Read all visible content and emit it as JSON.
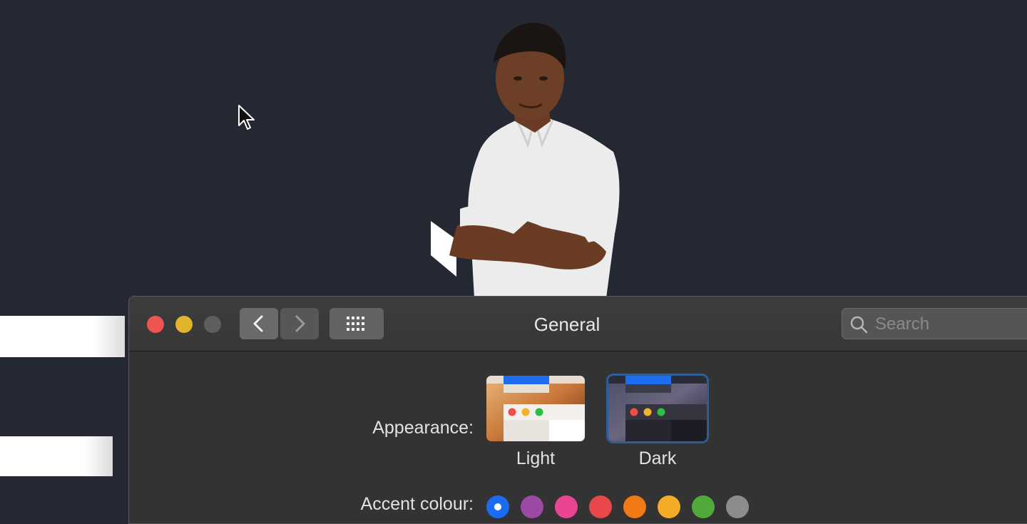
{
  "window": {
    "title": "General",
    "search_placeholder": "Search"
  },
  "appearance": {
    "label": "Appearance:",
    "options": [
      {
        "name": "Light",
        "selected": false
      },
      {
        "name": "Dark",
        "selected": true
      }
    ]
  },
  "accent": {
    "label": "Accent colour:",
    "selected_index": 0,
    "colors": [
      "#1a6cf5",
      "#9d4aa7",
      "#e94592",
      "#e8484a",
      "#f07a14",
      "#f4ac26",
      "#52a93b",
      "#8c8c8c"
    ]
  },
  "icons": {
    "traffic": [
      "close-icon",
      "minimize-icon",
      "zoom-icon"
    ],
    "nav": [
      "chevron-left-icon",
      "chevron-right-icon",
      "grid-icon"
    ],
    "search": "search-icon",
    "cursor": "pointer-cursor-icon"
  }
}
